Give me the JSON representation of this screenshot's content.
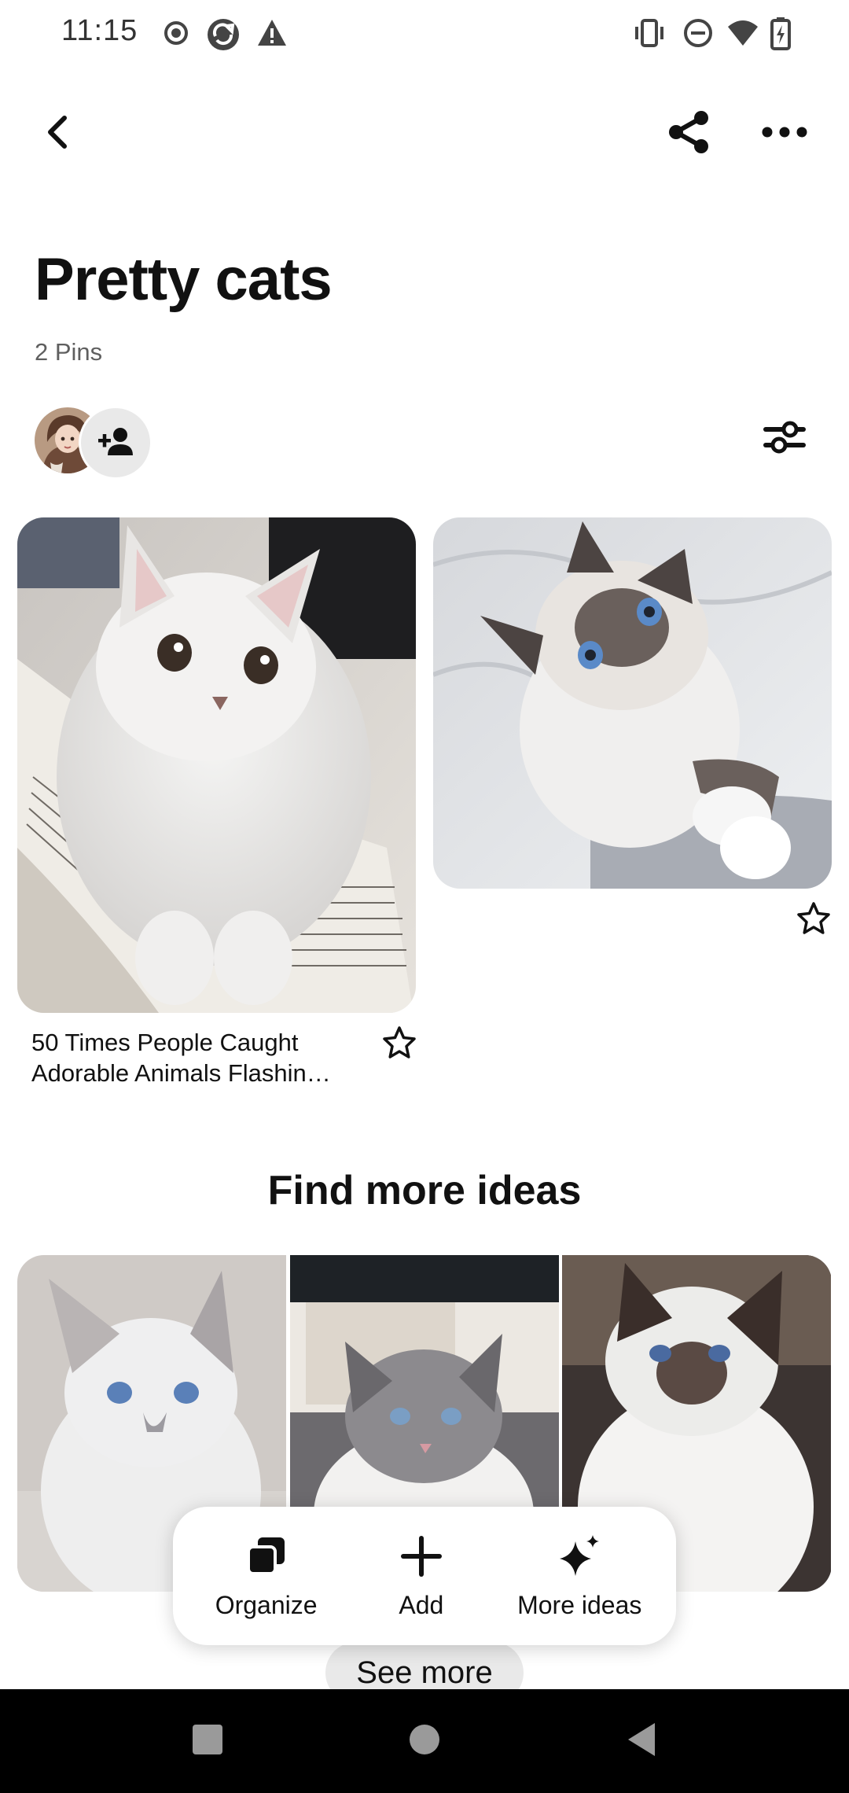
{
  "status_bar": {
    "time": "11:15",
    "icons": [
      "record-icon",
      "sync-icon",
      "warning-icon",
      "vibrate-icon",
      "do-not-disturb-icon",
      "wifi-icon",
      "battery-charging-icon"
    ]
  },
  "app_bar": {
    "back_icon": "back-arrow-icon",
    "share_icon": "share-icon",
    "more_icon": "more-horizontal-icon"
  },
  "board": {
    "title": "Pretty cats",
    "pin_count": "2 Pins",
    "collaborator_icon": "add-person-icon",
    "filter_icon": "filter-sliders-icon"
  },
  "pins": [
    {
      "title": "50 Times People Caught\nAdorable Animals Flashin…",
      "image": "white persian cat on open book",
      "star_icon": "star-outline-icon"
    },
    {
      "title": "",
      "image": "ragdoll kitten on white sheets",
      "star_icon": "star-outline-icon"
    }
  ],
  "find_more": {
    "heading": "Find more ideas",
    "images": [
      "siamese kitten",
      "ragdoll kitten",
      "birman kitten"
    ],
    "see_more_label": "See more"
  },
  "action_bar": {
    "items": [
      {
        "label": "Organize",
        "icon": "organize-icon"
      },
      {
        "label": "Add",
        "icon": "plus-icon"
      },
      {
        "label": "More ideas",
        "icon": "sparkle-icon"
      }
    ]
  },
  "nav_bar": {
    "icons": [
      "recents-square-icon",
      "home-circle-icon",
      "back-triangle-icon"
    ]
  },
  "colors": {
    "text_primary": "#111111",
    "text_secondary": "#5f5f5f",
    "chip_background": "#e9e9e9",
    "nav_background": "#000000"
  }
}
